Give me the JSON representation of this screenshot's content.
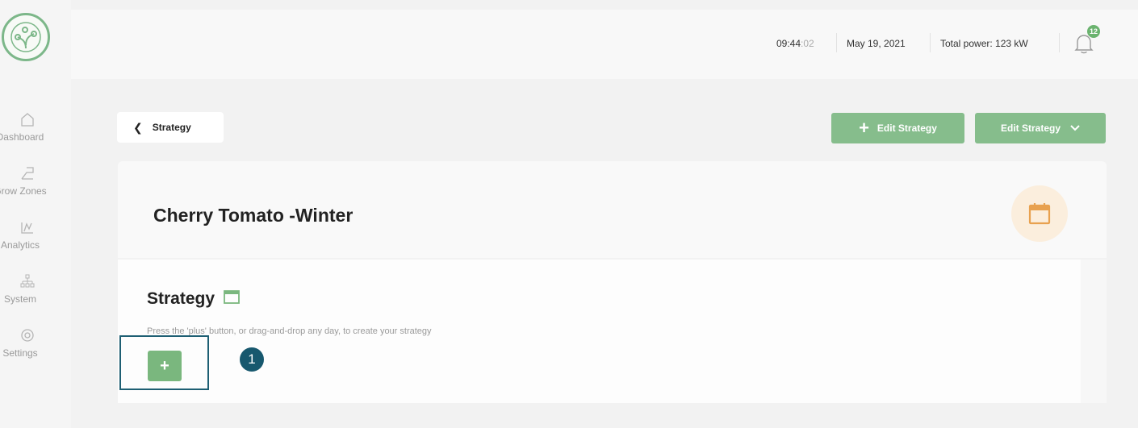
{
  "sidebar": {
    "items": [
      {
        "label": "Dashboard",
        "icon": "home-icon"
      },
      {
        "label": "Grow Zones",
        "icon": "grow-zones-icon"
      },
      {
        "label": "Analytics",
        "icon": "analytics-icon"
      },
      {
        "label": "System",
        "icon": "system-icon"
      },
      {
        "label": "Settings",
        "icon": "settings-icon"
      }
    ]
  },
  "header": {
    "time_main": "09:44",
    "time_seconds": ":02",
    "date": "May 19, 2021",
    "total_power": "Total power: 123 kW",
    "notification_count": "12"
  },
  "toolbar": {
    "back_label": "Strategy",
    "edit_strategy_add_label": "Edit Strategy",
    "edit_strategy_menu_label": "Edit Strategy"
  },
  "card": {
    "title": "Cherry Tomato -Winter"
  },
  "strategy": {
    "heading": "Strategy",
    "hint": "Press the 'plus' button, or drag-and-drop any day, to create your strategy",
    "add_label": "+"
  },
  "annotation": {
    "step_number": "1"
  },
  "colors": {
    "accent_green": "#86bd8c",
    "calendar_orange": "#e8a14f",
    "annotation_blue": "#17586e"
  }
}
